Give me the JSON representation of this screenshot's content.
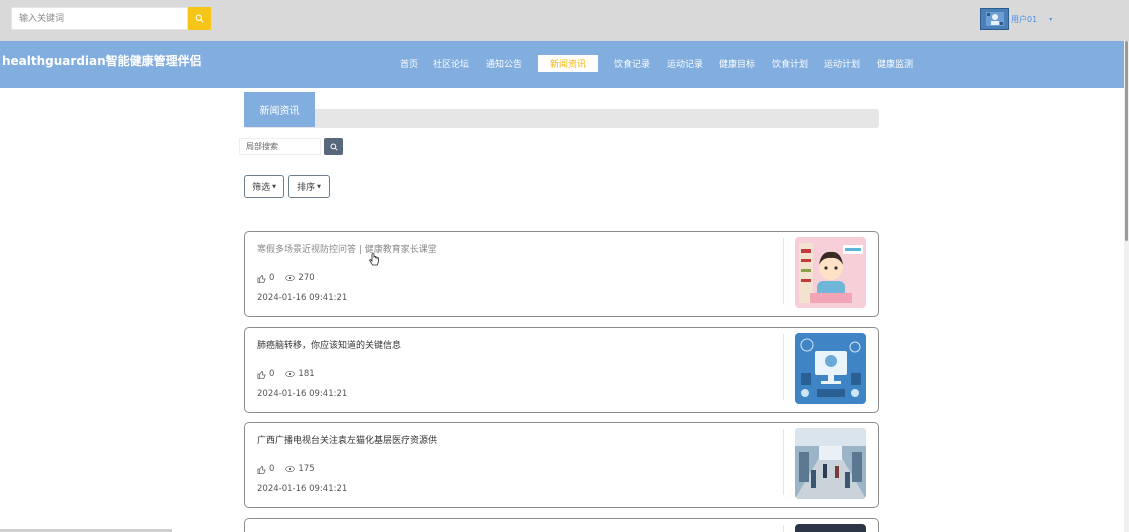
{
  "topbar": {
    "search_placeholder": "输入关键词",
    "username": "用户01"
  },
  "nav": {
    "brand": "healthguardian智能健康管理伴侣",
    "items": [
      {
        "label": "首页"
      },
      {
        "label": "社区论坛"
      },
      {
        "label": "通知公告"
      },
      {
        "label": "新闻资讯"
      },
      {
        "label": "饮食记录"
      },
      {
        "label": "运动记录"
      },
      {
        "label": "健康目标"
      },
      {
        "label": "饮食计划"
      },
      {
        "label": "运动计划"
      },
      {
        "label": "健康监测"
      }
    ],
    "active_index": 3
  },
  "section": {
    "title": "新闻资讯",
    "local_search_placeholder": "局部搜索",
    "filter_label": "筛选",
    "sort_label": "排序"
  },
  "news": [
    {
      "title": "寒假多场景近视防控问答 | 健康教育家长课堂",
      "likes": "0",
      "views": "270",
      "date": "2024-01-16 09:41:21"
    },
    {
      "title": "肺癌脑转移，你应该知道的关键信息",
      "likes": "0",
      "views": "181",
      "date": "2024-01-16 09:41:21"
    },
    {
      "title": "广西广播电视台关注袁左猫化基层医疗资源供",
      "likes": "0",
      "views": "175",
      "date": "2024-01-16 09:41:21"
    }
  ],
  "colors": {
    "nav_bg": "#82addf",
    "active_text": "#f5b400",
    "search_btn": "#f5c518"
  }
}
